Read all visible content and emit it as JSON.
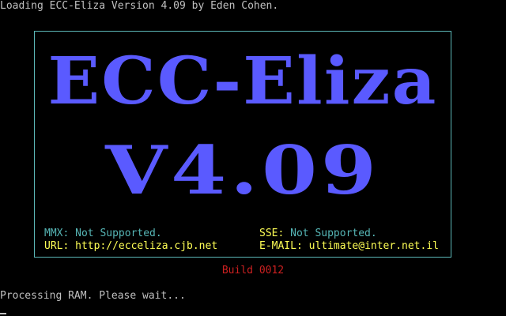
{
  "console": {
    "loading_line": "Loading ECC-Eliza Version 4.09 by Eden Cohen.",
    "processing_line": "Processing RAM. Please wait...",
    "cursor": "_"
  },
  "splash": {
    "title": "ECC-Eliza",
    "version": "V4.09",
    "mmx_label": "MMX:",
    "mmx_value": "Not Supported.",
    "sse_label": "SSE:",
    "sse_value": "Not Supported.",
    "url_label": "URL:",
    "url_value": "http://ecceliza.cjb.net",
    "email_label": "E-MAIL:",
    "email_value": "ultimate@inter.net.il"
  },
  "build": "Build 0012",
  "colors": {
    "background": "#000000",
    "console_text": "#c0c0c0",
    "box_border": "#5cb8b8",
    "big_text": "#5a5aff",
    "label_cyan": "#56b6b6",
    "value_yellow": "#ffff55",
    "build_red": "#cc2020"
  }
}
